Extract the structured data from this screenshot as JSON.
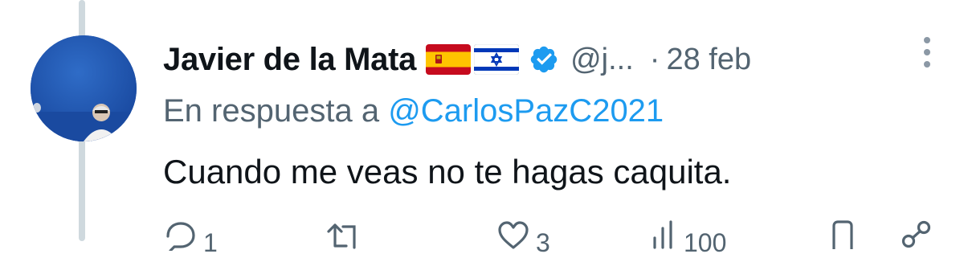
{
  "tweet": {
    "author_name": "Javier de la Mata",
    "flags": [
      "spain-flag",
      "israel-flag"
    ],
    "verified": true,
    "handle": "@j...",
    "separator": "·",
    "date": "28 feb",
    "reply_prefix": "En respuesta a",
    "reply_to": "@CarlosPazC2021",
    "text": "Cuando me veas no te hagas caquita."
  },
  "actions": {
    "reply_count": "1",
    "like_count": "3",
    "views_count": "100"
  },
  "colors": {
    "text_primary": "#0f1419",
    "text_secondary": "#536471",
    "link_blue": "#1d9bf0",
    "verified_blue": "#1d9bf0",
    "thread_line": "#cfd9de"
  },
  "icons": [
    "more-icon",
    "verified-badge-icon",
    "reply-icon",
    "retweet-icon",
    "like-icon",
    "views-icon",
    "bookmark-icon",
    "share-icon"
  ]
}
